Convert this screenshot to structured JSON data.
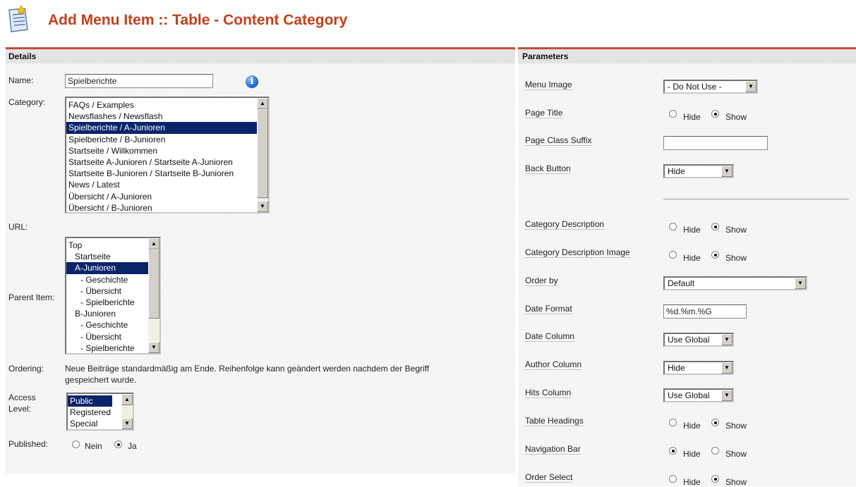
{
  "header": {
    "title": "Add Menu Item :: Table - Content Category",
    "icon": "menu-document-icon"
  },
  "details": {
    "heading": "Details",
    "name": {
      "label": "Name:",
      "value": "Spielberichte"
    },
    "category": {
      "label": "Category:",
      "options": [
        "FAQs / Examples",
        "Newsflashes / Newsflash",
        "Spielberichte / A-Junioren",
        "Spielberichte / B-Junioren",
        "Startseite / Willkommen",
        "Startseite A-Junioren / Startseite A-Junioren",
        "Startseite B-Junioren / Startseite B-Junioren",
        "News / Latest",
        "Übersicht / A-Junioren",
        "Übersicht / B-Junioren"
      ],
      "selected": "Spielberichte / A-Junioren"
    },
    "url": {
      "label": "URL:"
    },
    "parent": {
      "label": "Parent Item:",
      "options": [
        "Top",
        "Startseite",
        "A-Junioren",
        "- Geschichte",
        "- Übersicht",
        "- Spielberichte",
        "B-Junioren",
        "- Geschichte",
        "- Übersicht",
        "- Spielberichte"
      ],
      "selected": "A-Junioren"
    },
    "ordering": {
      "label": "Ordering:",
      "text_line1": "Neue Beiträge standardmäßig am Ende. Reihenfolge kann geändert werden nachdem der Begriff",
      "text_line2": "gespeichert wurde."
    },
    "access": {
      "label_line1": "Access",
      "label_line2": "Level:",
      "options": [
        "Public",
        "Registered",
        "Special"
      ],
      "selected": "Public"
    },
    "published": {
      "label": "Published:",
      "no": "Nein",
      "yes": "Ja",
      "value": "Ja"
    }
  },
  "parameters": {
    "heading": "Parameters",
    "rows": {
      "menu_image": {
        "label": "Menu Image",
        "value": "- Do Not Use -"
      },
      "page_title": {
        "label": "Page Title",
        "hide": "Hide",
        "show": "Show",
        "value": "Show"
      },
      "page_class_suffix": {
        "label": "Page Class Suffix",
        "value": ""
      },
      "back_button": {
        "label": "Back Button",
        "value": "Hide"
      },
      "category_description": {
        "label": "Category Description",
        "hide": "Hide",
        "show": "Show",
        "value": "Show"
      },
      "category_description_image": {
        "label": "Category Description Image",
        "hide": "Hide",
        "show": "Show",
        "value": "Show"
      },
      "order_by": {
        "label": "Order by",
        "value": "Default"
      },
      "date_format": {
        "label": "Date Format",
        "value": "%d.%m.%G"
      },
      "date_column": {
        "label": "Date Column",
        "value": "Use Global"
      },
      "author_column": {
        "label": "Author Column",
        "value": "Hide"
      },
      "hits_column": {
        "label": "Hits Column",
        "value": "Use Global"
      },
      "table_headings": {
        "label": "Table Headings",
        "hide": "Hide",
        "show": "Show",
        "value": "Show"
      },
      "navigation_bar": {
        "label": "Navigation Bar",
        "hide": "Hide",
        "show": "Show",
        "value": "Hide"
      },
      "order_select": {
        "label": "Order Select",
        "hide": "Hide",
        "show": "Show",
        "value": "Show"
      }
    }
  }
}
